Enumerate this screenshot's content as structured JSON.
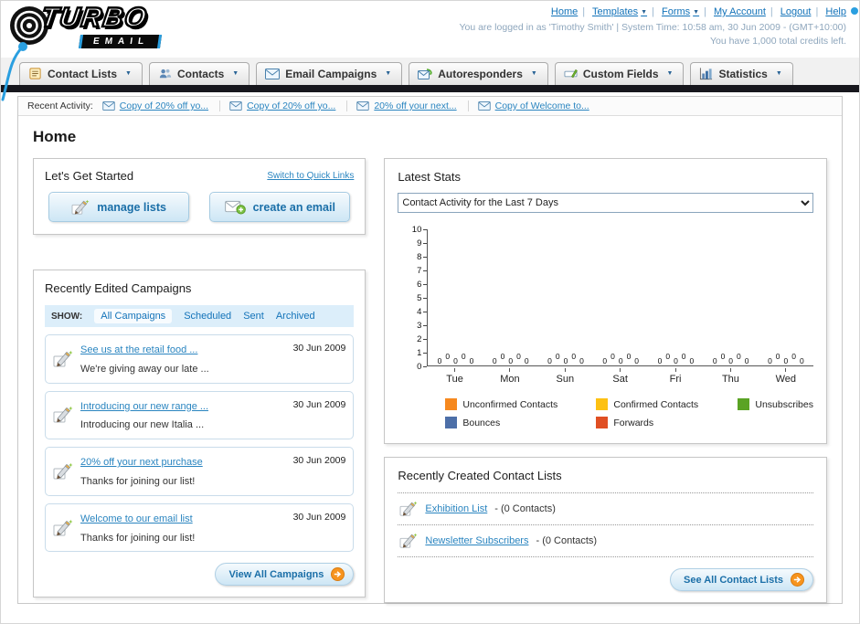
{
  "header": {
    "logo_line1": "TURBO",
    "logo_line2": "EMAIL",
    "nav_links": [
      "Home",
      "Templates",
      "Forms",
      "My Account",
      "Logout",
      "Help"
    ],
    "status_line": "You are logged in as 'Timothy Smith' | System Time: 10:58 am, 30 Jun 2009 - (GMT+10:00)",
    "credits_line": "You have 1,000 total credits left."
  },
  "nav_tabs": [
    {
      "label": "Contact Lists"
    },
    {
      "label": "Contacts"
    },
    {
      "label": "Email Campaigns"
    },
    {
      "label": "Autoresponders"
    },
    {
      "label": "Custom Fields"
    },
    {
      "label": "Statistics"
    }
  ],
  "recent_activity": {
    "label": "Recent Activity:",
    "items": [
      "Copy of 20% off yo...",
      "Copy of 20% off yo...",
      "20% off your next...",
      "Copy of Welcome to..."
    ]
  },
  "page_title": "Home",
  "get_started": {
    "title": "Let's Get Started",
    "switch_link": "Switch to Quick Links",
    "manage_lists_label": "manage lists",
    "create_email_label": "create an email"
  },
  "campaigns": {
    "title": "Recently Edited Campaigns",
    "show_label": "SHOW:",
    "filters": [
      "All Campaigns",
      "Scheduled",
      "Sent",
      "Archived"
    ],
    "active_filter": "All Campaigns",
    "items": [
      {
        "title": "See us at the retail food ...",
        "subtitle": "We're giving away our late ...",
        "date": "30 Jun 2009"
      },
      {
        "title": "Introducing our new range ...",
        "subtitle": "Introducing our new Italia ...",
        "date": "30 Jun 2009"
      },
      {
        "title": "20% off your next purchase",
        "subtitle": "Thanks for joining our list!",
        "date": "30 Jun 2009"
      },
      {
        "title": "Welcome to our email list",
        "subtitle": "Thanks for joining our list!",
        "date": "30 Jun 2009"
      }
    ],
    "view_all_label": "View All Campaigns"
  },
  "stats": {
    "title": "Latest Stats",
    "dropdown_value": "Contact Activity for the Last 7 Days"
  },
  "chart_data": {
    "type": "bar",
    "title": "Contact Activity for the Last 7 Days",
    "categories": [
      "Tue",
      "Mon",
      "Sun",
      "Sat",
      "Fri",
      "Thu",
      "Wed"
    ],
    "series": [
      {
        "name": "Unconfirmed Contacts",
        "color": "#f6891f",
        "values": [
          0,
          0,
          0,
          0,
          0,
          0,
          0
        ]
      },
      {
        "name": "Confirmed Contacts",
        "color": "#fdc113",
        "values": [
          0,
          0,
          0,
          0,
          0,
          0,
          0
        ]
      },
      {
        "name": "Unsubscribes",
        "color": "#5aa324",
        "values": [
          0,
          0,
          0,
          0,
          0,
          0,
          0
        ]
      },
      {
        "name": "Bounces",
        "color": "#4d6fa8",
        "values": [
          0,
          0,
          0,
          0,
          0,
          0,
          0
        ]
      },
      {
        "name": "Forwards",
        "color": "#e04f23",
        "values": [
          0,
          0,
          0,
          0,
          0,
          0,
          0
        ]
      }
    ],
    "xlabel": "",
    "ylabel": "",
    "ylim": [
      0,
      10
    ],
    "yticks": [
      0,
      1,
      2,
      3,
      4,
      5,
      6,
      7,
      8,
      9,
      10
    ],
    "grid": false,
    "legend_position": "bottom",
    "value_labels_shown": true
  },
  "contact_lists": {
    "title": "Recently Created Contact Lists",
    "items": [
      {
        "name": "Exhibition List",
        "detail": "- (0 Contacts)"
      },
      {
        "name": "Newsletter Subscribers",
        "detail": "- (0 Contacts)"
      }
    ],
    "see_all_label": "See All Contact Lists"
  }
}
